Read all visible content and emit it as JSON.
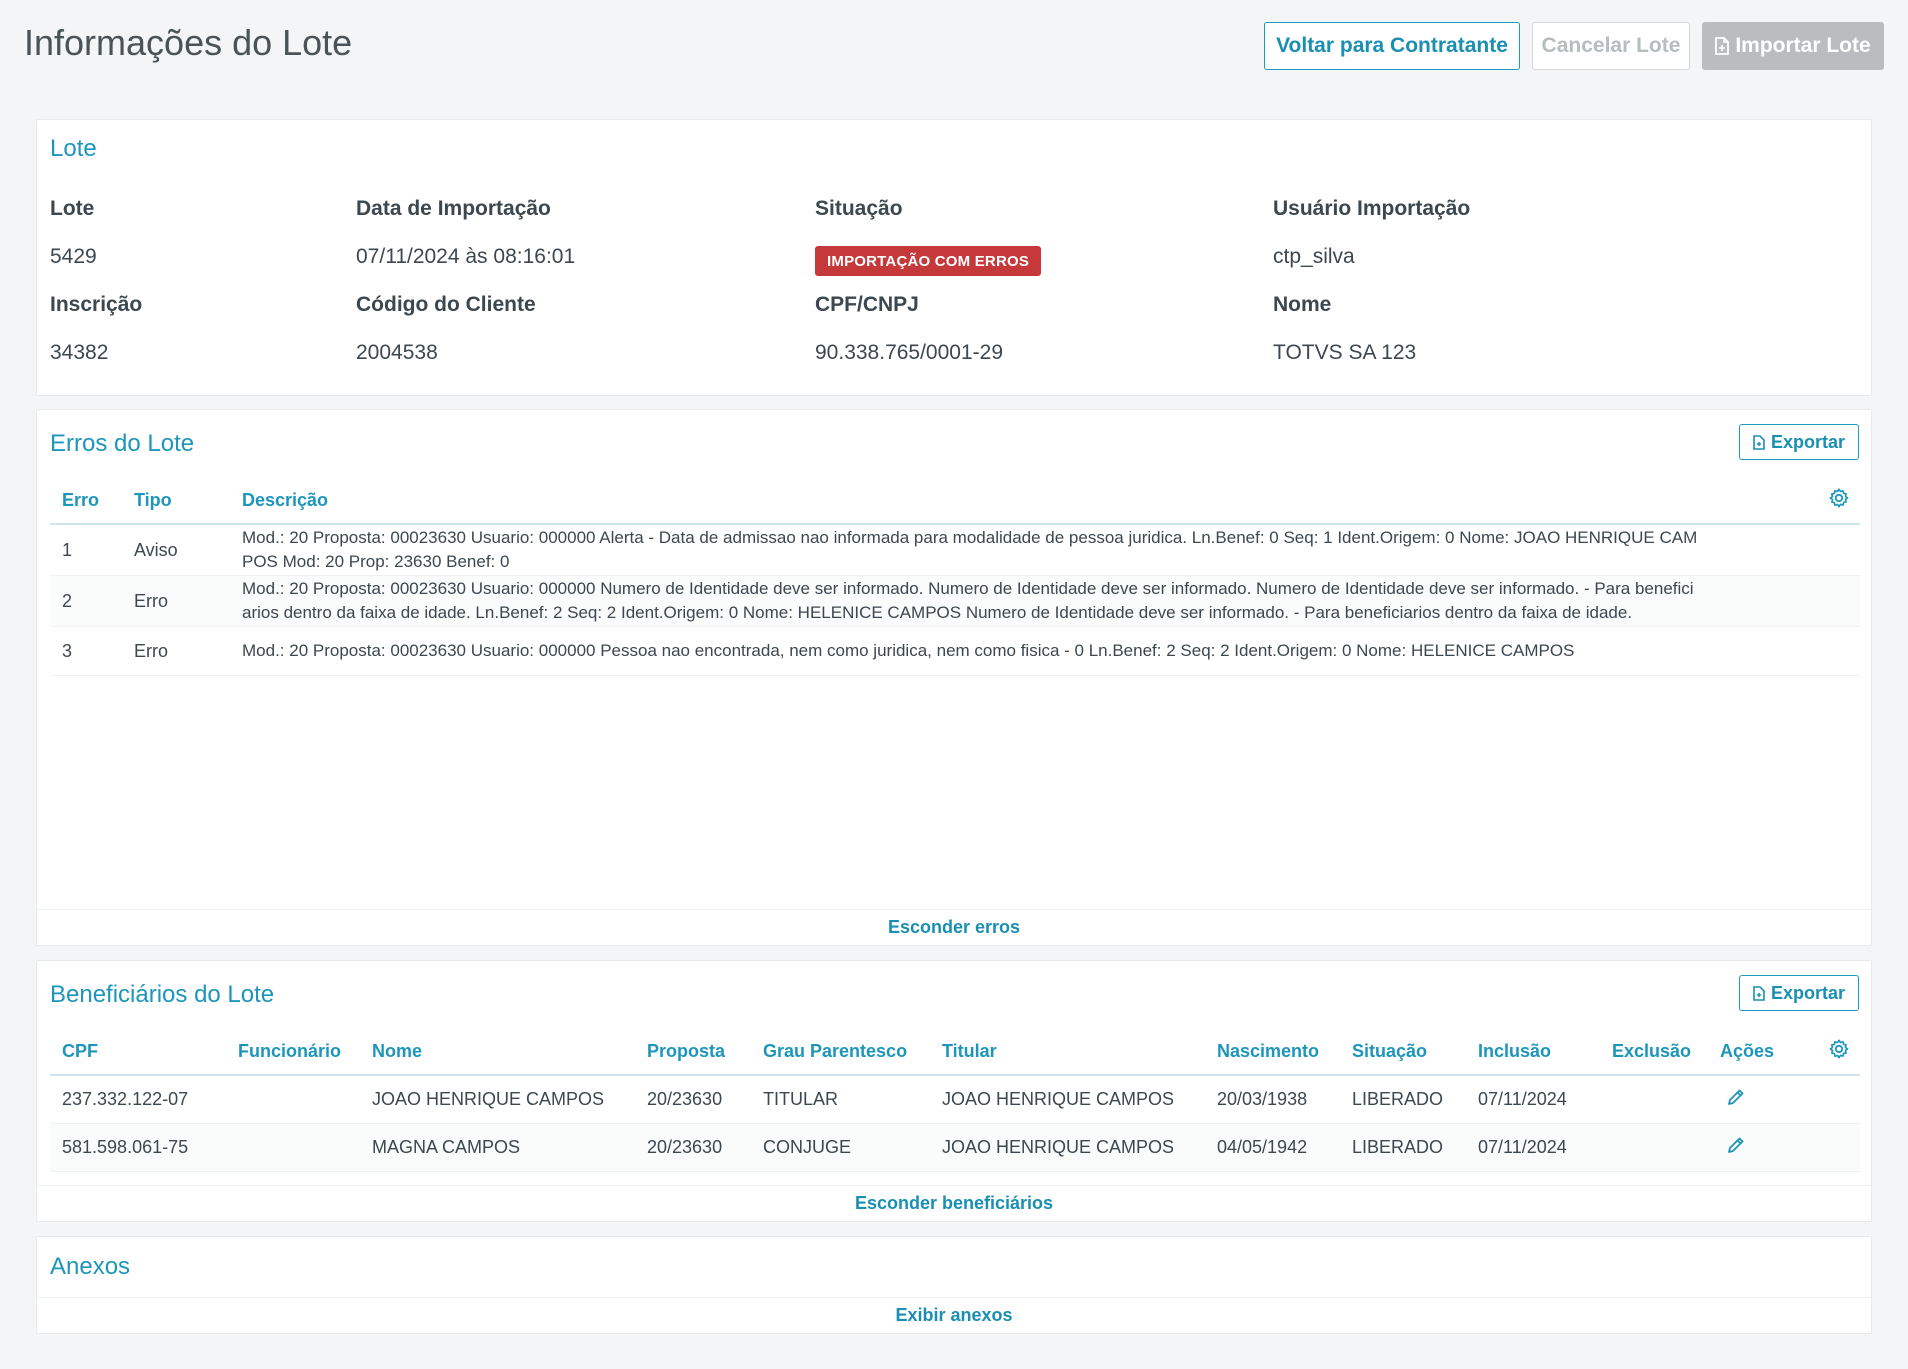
{
  "header": {
    "title": "Informações do Lote",
    "btn_voltar": "Voltar para Contratante",
    "btn_cancelar": "Cancelar Lote",
    "btn_importar": "Importar Lote"
  },
  "lote": {
    "section_title": "Lote",
    "fields": [
      {
        "label": "Lote",
        "value": "5429"
      },
      {
        "label": "Data de Importação",
        "value": "07/11/2024 às 08:16:01"
      },
      {
        "label": "Situação",
        "value": "IMPORTAÇÃO COM ERROS"
      },
      {
        "label": "Usuário Importação",
        "value": "ctp_silva"
      },
      {
        "label": "Inscrição",
        "value": "34382"
      },
      {
        "label": "Código do Cliente",
        "value": "2004538"
      },
      {
        "label": "CPF/CNPJ",
        "value": "90.338.765/0001-29"
      },
      {
        "label": "Nome",
        "value": "TOTVS SA 123"
      }
    ],
    "badge_color": "#c5393b"
  },
  "erros": {
    "section_title": "Erros do Lote",
    "export_label": "Exportar",
    "columns": [
      "Erro",
      "Tipo",
      "Descrição"
    ],
    "rows": [
      {
        "erro": "1",
        "tipo": "Aviso",
        "descricao_l1": "Mod.: 20 Proposta: 00023630 Usuario: 000000 Alerta - Data de admissao nao informada para modalidade de pessoa juridica. Ln.Benef: 0 Seq: 1 Ident.Origem: 0 Nome: JOAO HENRIQUE CAM",
        "descricao_l2": "POS Mod: 20 Prop: 23630 Benef: 0"
      },
      {
        "erro": "2",
        "tipo": "Erro",
        "descricao_l1": "Mod.: 20 Proposta: 00023630 Usuario: 000000 Numero de Identidade deve ser informado. Numero de Identidade deve ser informado. Numero de Identidade deve ser informado. - Para benefici",
        "descricao_l2": "arios dentro da faixa de idade. Ln.Benef: 2 Seq: 2 Ident.Origem: 0 Nome: HELENICE CAMPOS Numero de Identidade deve ser informado. - Para beneficiarios dentro da faixa de idade."
      },
      {
        "erro": "3",
        "tipo": "Erro",
        "descricao_l1": "Mod.: 20 Proposta: 00023630 Usuario: 000000 Pessoa nao encontrada, nem como juridica, nem como fisica - 0 Ln.Benef: 2 Seq: 2 Ident.Origem: 0 Nome: HELENICE CAMPOS",
        "descricao_l2": ""
      }
    ],
    "footer_link": "Esconder erros"
  },
  "beneficiarios": {
    "section_title": "Beneficiários do Lote",
    "export_label": "Exportar",
    "columns": [
      "CPF",
      "Funcionário",
      "Nome",
      "Proposta",
      "Grau Parentesco",
      "Titular",
      "Nascimento",
      "Situação",
      "Inclusão",
      "Exclusão",
      "Ações"
    ],
    "rows": [
      {
        "cpf": "237.332.122-07",
        "funcionario": "",
        "nome": "JOAO HENRIQUE CAMPOS",
        "proposta": "20/23630",
        "grau": "TITULAR",
        "titular": "JOAO HENRIQUE CAMPOS",
        "nascimento": "20/03/1938",
        "situacao": "LIBERADO",
        "inclusao": "07/11/2024",
        "exclusao": ""
      },
      {
        "cpf": "581.598.061-75",
        "funcionario": "",
        "nome": "MAGNA CAMPOS",
        "proposta": "20/23630",
        "grau": "CONJUGE",
        "titular": "JOAO HENRIQUE CAMPOS",
        "nascimento": "04/05/1942",
        "situacao": "LIBERADO",
        "inclusao": "07/11/2024",
        "exclusao": ""
      }
    ],
    "footer_link": "Esconder beneficiários"
  },
  "anexos": {
    "section_title": "Anexos",
    "footer_link": "Exibir anexos"
  },
  "icons": {
    "export": "file-export-icon",
    "gear": "gear-icon",
    "edit": "pencil-icon"
  },
  "colors": {
    "accent": "#1d96ba",
    "error_badge": "#c5393b",
    "disabled": "#b9bdc0"
  }
}
